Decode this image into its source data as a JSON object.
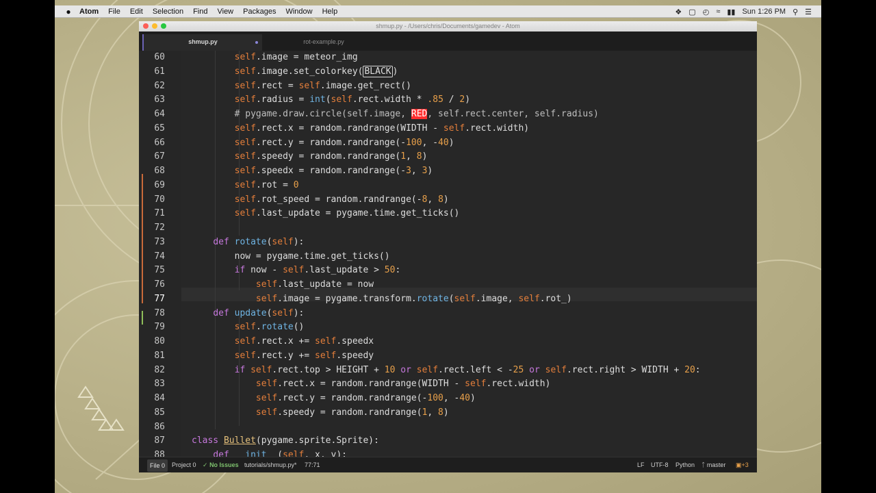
{
  "menubar": {
    "apple": "",
    "items": [
      "Atom",
      "File",
      "Edit",
      "Selection",
      "Find",
      "View",
      "Packages",
      "Window",
      "Help"
    ],
    "clock": "Sun 1:26 PM"
  },
  "window": {
    "title": "shmup.py - /Users/chris/Documents/gamedev - Atom",
    "tabs": [
      {
        "label": "shmup.py",
        "active": true,
        "modified": true
      },
      {
        "label": "rot-example.py",
        "active": false
      }
    ]
  },
  "editor": {
    "current_line": 77,
    "lines": [
      {
        "num": "60",
        "text": "            self.image = meteor_img"
      },
      {
        "num": "61",
        "text": "            self.image.set_colorkey(BLACK)"
      },
      {
        "num": "62",
        "text": "            self.rect = self.image.get_rect()"
      },
      {
        "num": "63",
        "text": "            self.radius = int(self.rect.width * .85 / 2)"
      },
      {
        "num": "64",
        "text": "            # pygame.draw.circle(self.image, RED, self.rect.center, self.radius)"
      },
      {
        "num": "65",
        "text": "            self.rect.x = random.randrange(WIDTH - self.rect.width)"
      },
      {
        "num": "66",
        "text": "            self.rect.y = random.randrange(-100, -40)"
      },
      {
        "num": "67",
        "text": "            self.speedy = random.randrange(1, 8)"
      },
      {
        "num": "68",
        "text": "            self.speedx = random.randrange(-3, 3)"
      },
      {
        "num": "69",
        "text": "            self.rot = 0"
      },
      {
        "num": "70",
        "text": "            self.rot_speed = random.randrange(-8, 8)"
      },
      {
        "num": "71",
        "text": "            self.last_update = pygame.time.get_ticks()"
      },
      {
        "num": "72",
        "text": ""
      },
      {
        "num": "73",
        "text": "        def rotate(self):"
      },
      {
        "num": "74",
        "text": "            now = pygame.time.get_ticks()"
      },
      {
        "num": "75",
        "text": "            if now - self.last_update > 50:"
      },
      {
        "num": "76",
        "text": "                self.last_update = now"
      },
      {
        "num": "77",
        "text": "                self.image = pygame.transform.rotate(self.image, self.rot_)"
      },
      {
        "num": "78",
        "text": "        def update(self):"
      },
      {
        "num": "79",
        "text": "            self.rotate()"
      },
      {
        "num": "80",
        "text": "            self.rect.x += self.speedx"
      },
      {
        "num": "81",
        "text": "            self.rect.y += self.speedy"
      },
      {
        "num": "82",
        "text": "            if self.rect.top > HEIGHT + 10 or self.rect.left < -25 or self.rect.right > WIDTH + 20:"
      },
      {
        "num": "83",
        "text": "                self.rect.x = random.randrange(WIDTH - self.rect.width)"
      },
      {
        "num": "84",
        "text": "                self.rect.y = random.randrange(-100, -40)"
      },
      {
        "num": "85",
        "text": "                self.speedy = random.randrange(1, 8)"
      },
      {
        "num": "86",
        "text": ""
      },
      {
        "num": "87",
        "text": "    class Bullet(pygame.sprite.Sprite):"
      },
      {
        "num": "88",
        "text": "        def __init__(self, x, y):"
      }
    ]
  },
  "statusbar": {
    "file_btn": "File 0",
    "project": "Project 0",
    "issues": "No Issues",
    "path": "tutorials/shmup.py*",
    "cursor": "77:71",
    "line_ending": "LF",
    "encoding": "UTF-8",
    "grammar": "Python",
    "branch": "master",
    "updates": "+3"
  },
  "colors": {
    "self": "#e57f3b",
    "keyword": "#c678dd",
    "number": "#e8a04a",
    "function": "#6fb4e3",
    "accent": "#6c63b6"
  }
}
